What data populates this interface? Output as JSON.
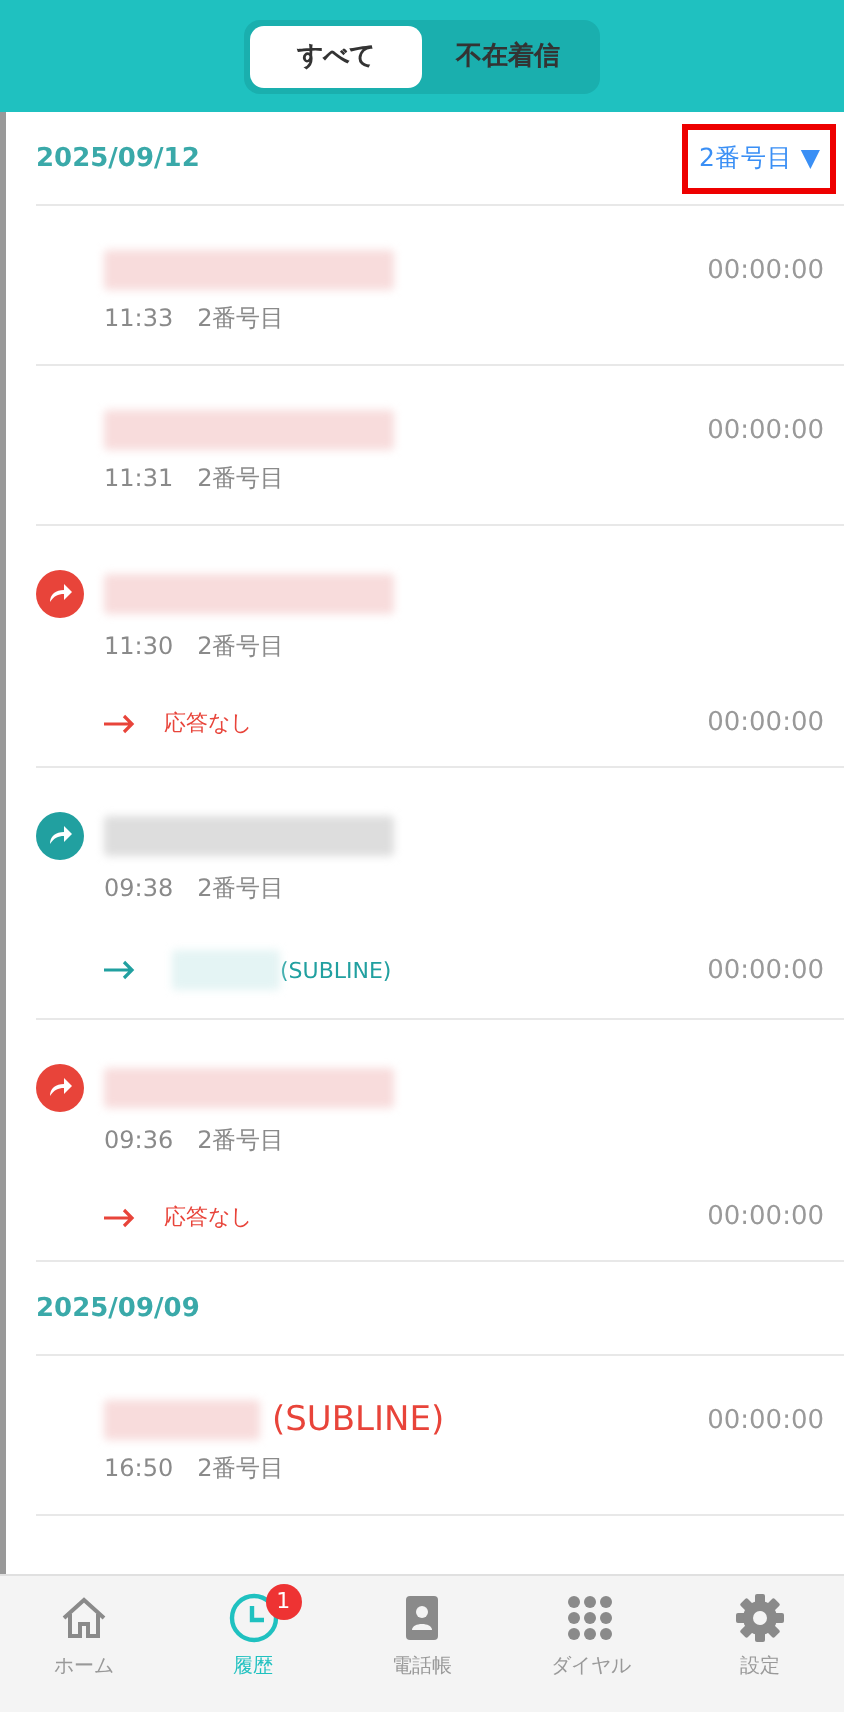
{
  "tabs": [
    {
      "label": "すべて",
      "selected": true
    },
    {
      "label": "不在着信",
      "selected": false
    }
  ],
  "groups": [
    {
      "date": "2025/09/12",
      "filter": {
        "label": "2番号目 ▼",
        "highlighted": true
      },
      "calls": [
        {
          "kind": "plain",
          "time": "11:33",
          "line": "2番号目",
          "duration": "00:00:00"
        },
        {
          "kind": "plain",
          "time": "11:31",
          "line": "2番号目",
          "duration": "00:00:00"
        },
        {
          "kind": "missed",
          "time": "11:30",
          "line": "2番号目",
          "route": {
            "label": "応答なし"
          },
          "duration": "00:00:00"
        },
        {
          "kind": "answered",
          "time": "09:38",
          "line": "2番号目",
          "route": {
            "label": "(SUBLINE)",
            "redacted": true
          },
          "duration": "00:00:00"
        },
        {
          "kind": "missed",
          "time": "09:36",
          "line": "2番号目",
          "route": {
            "label": "応答なし"
          },
          "duration": "00:00:00"
        }
      ]
    },
    {
      "date": "2025/09/09",
      "calls": [
        {
          "kind": "plain",
          "time": "16:50",
          "line": "2番号目",
          "name_suffix": "(SUBLINE)",
          "duration": "00:00:00"
        }
      ]
    }
  ],
  "nav": [
    {
      "kind": "home",
      "label": "ホーム",
      "selected": false
    },
    {
      "kind": "history",
      "label": "履歴",
      "selected": true,
      "badge": "1"
    },
    {
      "kind": "contacts",
      "label": "電話帳",
      "selected": false
    },
    {
      "kind": "dial",
      "label": "ダイヤル",
      "selected": false
    },
    {
      "kind": "settings",
      "label": "設定",
      "selected": false
    }
  ]
}
